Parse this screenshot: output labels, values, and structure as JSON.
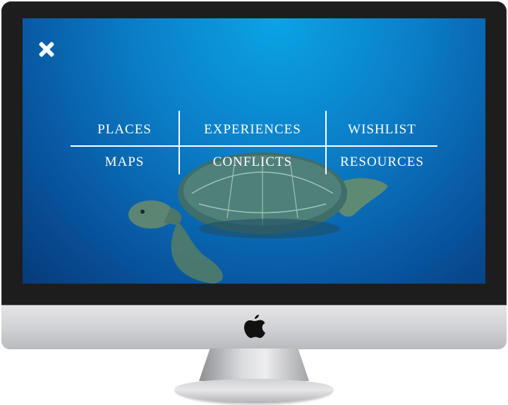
{
  "screen": {
    "close_icon": "close-icon",
    "background_image": "sea-turtle-underwater"
  },
  "menu": {
    "items": [
      {
        "label": "PLACES"
      },
      {
        "label": "EXPERIENCES"
      },
      {
        "label": "WISHLIST"
      },
      {
        "label": "MAPS"
      },
      {
        "label": "CONFLICTS"
      },
      {
        "label": "RESOURCES"
      }
    ]
  },
  "colors": {
    "ocean_top": "#0aa4e4",
    "ocean_bottom": "#063b78",
    "menu_text": "#ffffff",
    "bezel": "#1d1d1d"
  }
}
